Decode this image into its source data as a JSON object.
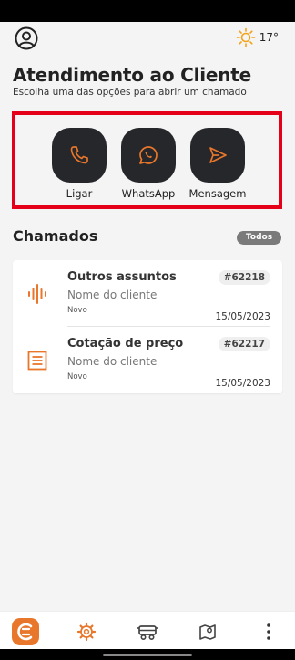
{
  "header": {
    "temperature": "17°",
    "title": "Atendimento ao Cliente",
    "subtitle": "Escolha uma das opções para abrir um chamado"
  },
  "options": [
    {
      "label": "Ligar",
      "icon": "phone-icon"
    },
    {
      "label": "WhatsApp",
      "icon": "whatsapp-icon"
    },
    {
      "label": "Mensagem",
      "icon": "send-icon"
    }
  ],
  "tickets_section": {
    "title": "Chamados",
    "filter": "Todos",
    "items": [
      {
        "subject": "Outros assuntos",
        "client": "Nome do cliente",
        "status": "Novo",
        "number": "#62218",
        "date": "15/05/2023",
        "icon": "audio-wave-icon"
      },
      {
        "subject": "Cotação de preço",
        "client": "Nome do cliente",
        "status": "Novo",
        "number": "#62217",
        "date": "15/05/2023",
        "icon": "document-list-icon"
      }
    ]
  },
  "nav": {
    "items": [
      "app-logo-icon",
      "settings-gear-icon",
      "vehicle-icon",
      "map-pin-icon",
      "more-vert-icon"
    ]
  },
  "colors": {
    "accent": "#e8762b",
    "dark_button": "#26272b",
    "highlight_border": "#e5001a"
  }
}
